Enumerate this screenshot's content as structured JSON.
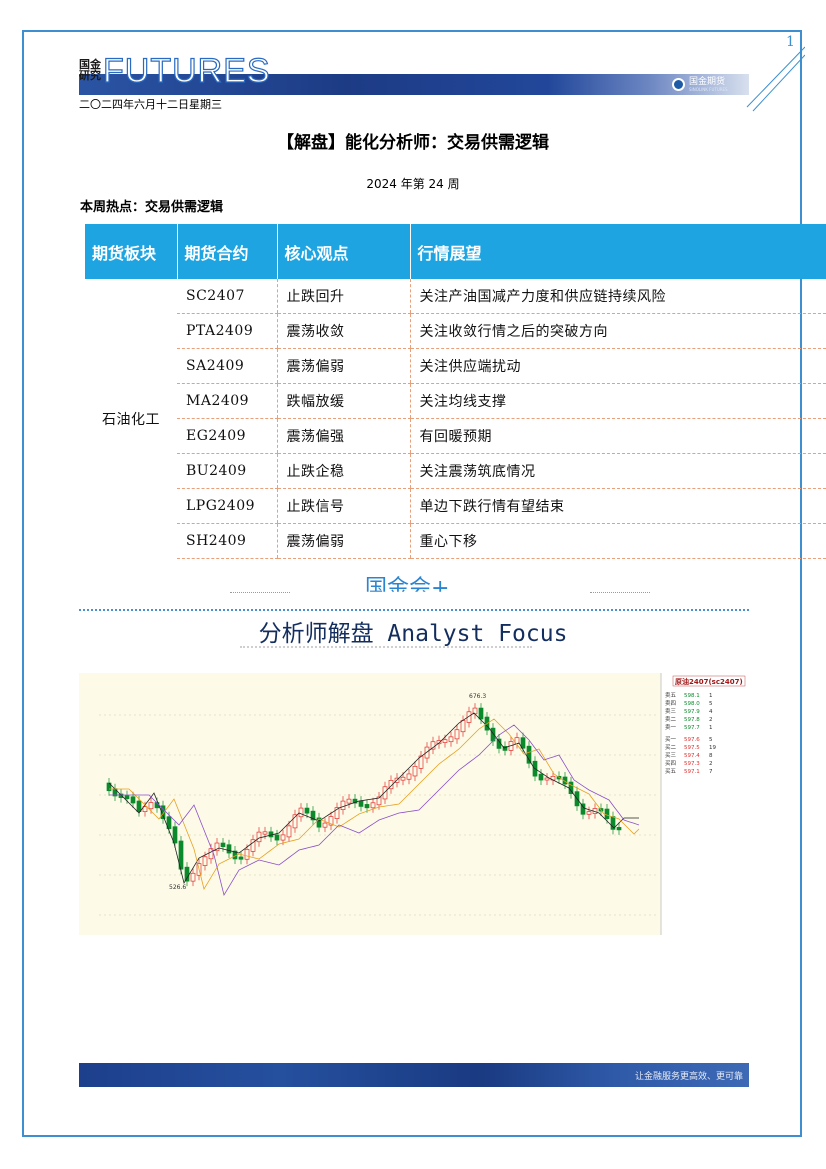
{
  "page_number": "1",
  "header": {
    "logo_small_1": "国金",
    "logo_small_2": "研究",
    "logo_big": "FUTURES",
    "brand_name": "国金期货",
    "brand_sub": "SINOLINK FUTURES"
  },
  "date": "二〇二四年六月十二日星期三",
  "title": "【解盘】能化分析师：交易供需逻辑",
  "week": "2024 年第 24 周",
  "hot_topic": "本周热点：交易供需逻辑",
  "table": {
    "headers": [
      "期货板块",
      "期货合约",
      "核心观点",
      "行情展望"
    ],
    "sector": "石油化工",
    "rows": [
      {
        "contract": "SC2407",
        "view": "止跌回升",
        "outlook": "关注产油国减产力度和供应链持续风险"
      },
      {
        "contract": "PTA2409",
        "view": "震荡收敛",
        "outlook": "关注收敛行情之后的突破方向"
      },
      {
        "contract": "SA2409",
        "view": "震荡偏弱",
        "outlook": "关注供应端扰动"
      },
      {
        "contract": "MA2409",
        "view": "跌幅放缓",
        "outlook": "关注均线支撑"
      },
      {
        "contract": "EG2409",
        "view": "震荡偏强",
        "outlook": "有回暖预期"
      },
      {
        "contract": "BU2409",
        "view": "止跌企稳",
        "outlook": "关注震荡筑底情况"
      },
      {
        "contract": "LPG2409",
        "view": "止跌信号",
        "outlook": "单边下跌行情有望结束"
      },
      {
        "contract": "SH2409",
        "view": "震荡偏弱",
        "outlook": "重心下移"
      }
    ]
  },
  "watermark": "国金会+",
  "section_title": "分析师解盘 Analyst Focus",
  "chart": {
    "panel_title": "原油2407(sc2407)",
    "high_label": "676.3",
    "low_label": "526.6",
    "quotes": [
      {
        "label": "卖五",
        "price": "598.1",
        "vol": "1"
      },
      {
        "label": "卖四",
        "price": "598.0",
        "vol": "5"
      },
      {
        "label": "卖三",
        "price": "597.9",
        "vol": "4"
      },
      {
        "label": "卖二",
        "price": "597.8",
        "vol": "2"
      },
      {
        "label": "卖一",
        "price": "597.7",
        "vol": "1"
      },
      {
        "label": "买一",
        "price": "597.6",
        "vol": "5"
      },
      {
        "label": "买二",
        "price": "597.5",
        "vol": "19"
      },
      {
        "label": "买三",
        "price": "597.4",
        "vol": "8"
      },
      {
        "label": "买四",
        "price": "597.3",
        "vol": "2"
      },
      {
        "label": "买五",
        "price": "597.1",
        "vol": "7"
      }
    ],
    "colors": {
      "up": "#e03030",
      "down": "#0a8a2a",
      "ma1": "#222222",
      "ma2": "#e8a020",
      "ma3": "#8a50c8",
      "ma4": "#30a0d0"
    }
  },
  "footer_text": "让金融服务更高效、更可靠"
}
